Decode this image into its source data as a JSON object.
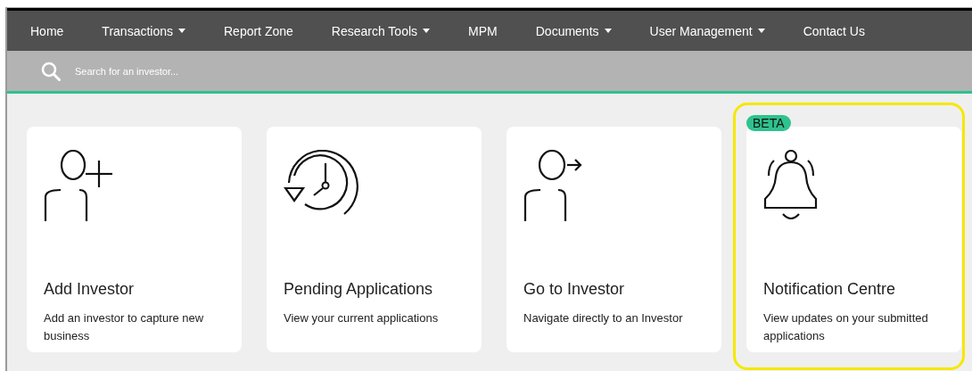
{
  "nav": [
    {
      "label": "Home",
      "dropdown": false
    },
    {
      "label": "Transactions",
      "dropdown": true
    },
    {
      "label": "Report Zone",
      "dropdown": false
    },
    {
      "label": "Research Tools",
      "dropdown": true
    },
    {
      "label": "MPM",
      "dropdown": false
    },
    {
      "label": "Documents",
      "dropdown": true
    },
    {
      "label": "User Management",
      "dropdown": true
    },
    {
      "label": "Contact Us",
      "dropdown": false
    }
  ],
  "search": {
    "placeholder": "Search for an investor..."
  },
  "cards": [
    {
      "kind": "person-plus",
      "title": "Add Investor",
      "description": "Add an investor to capture new business",
      "highlighted": false
    },
    {
      "kind": "clock-history",
      "title": "Pending Applications",
      "description": "View your current applications",
      "highlighted": false
    },
    {
      "kind": "person-arrow",
      "title": "Go to Investor",
      "description": "Navigate directly to an Investor",
      "highlighted": false
    },
    {
      "kind": "bell",
      "title": "Notification Centre",
      "description": "View updates on your submitted applications",
      "highlighted": true,
      "badge": "BETA"
    }
  ]
}
